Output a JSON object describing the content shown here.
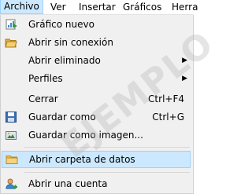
{
  "menubar": {
    "items": [
      "Archivo",
      "Ver",
      "Insertar",
      "Gráficos",
      "Herra"
    ]
  },
  "menu": {
    "items": [
      {
        "label": "Gráfico nuevo",
        "shortcut": "",
        "icon": "new-chart-icon"
      },
      {
        "label": "Abrir sin conexión",
        "shortcut": "",
        "icon": "open-folder-icon"
      },
      {
        "label": "Abrir eliminado",
        "shortcut": "",
        "icon": ""
      },
      {
        "label": "Perfiles",
        "shortcut": "",
        "icon": ""
      },
      {
        "label": "Cerrar",
        "shortcut": "Ctrl+F4",
        "icon": ""
      },
      {
        "label": "Guardar como",
        "shortcut": "Ctrl+G",
        "icon": "save-icon"
      },
      {
        "label": "Guardar como imagen...",
        "shortcut": "",
        "icon": "save-image-icon"
      },
      {
        "label": "Abrir carpeta de datos",
        "shortcut": "",
        "icon": "folder-icon"
      },
      {
        "label": "Abrir una cuenta",
        "shortcut": "",
        "icon": "add-user-icon"
      }
    ]
  },
  "watermark": "EJEMPLO"
}
